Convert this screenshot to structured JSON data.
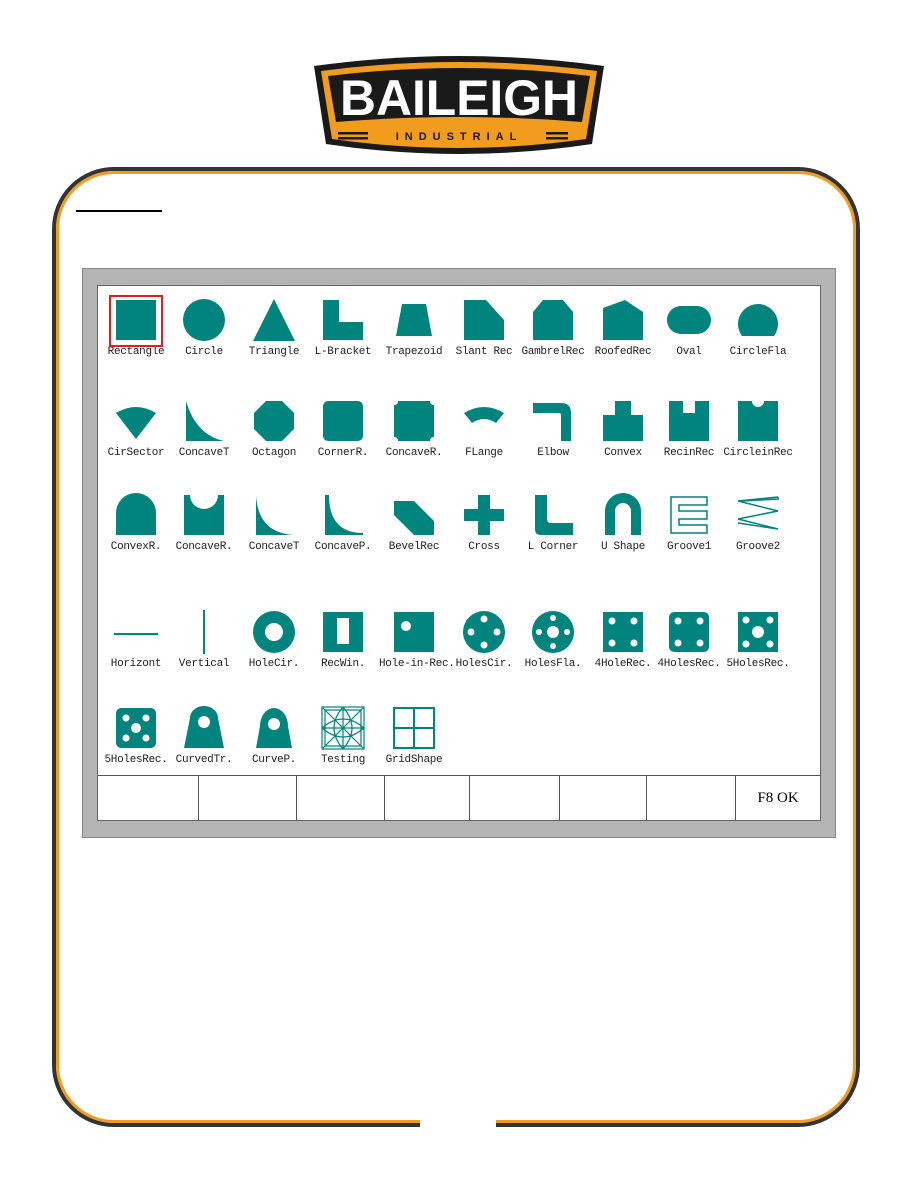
{
  "logo": {
    "brand": "BAILEIGH",
    "sub": "INDUSTRIAL",
    "colors": {
      "orange": "#f29c1f",
      "black": "#1a1a1a"
    }
  },
  "accent_color": "#00847d",
  "selection_color": "#e02020",
  "selected_index": 0,
  "shapes": [
    [
      {
        "label": "Rectangle",
        "icon": "rectangle"
      },
      {
        "label": "Circle",
        "icon": "circle"
      },
      {
        "label": "Triangle",
        "icon": "triangle"
      },
      {
        "label": "L-Bracket",
        "icon": "l-bracket"
      },
      {
        "label": "Trapezoid",
        "icon": "trapezoid"
      },
      {
        "label": "Slant Rec",
        "icon": "slant-rec"
      },
      {
        "label": "GambrelRec",
        "icon": "gambrel-rec"
      },
      {
        "label": "RoofedRec",
        "icon": "roofed-rec"
      },
      {
        "label": "Oval",
        "icon": "oval"
      },
      {
        "label": "CircleFla",
        "icon": "circle-flat"
      }
    ],
    [
      {
        "label": "CirSector",
        "icon": "cir-sector"
      },
      {
        "label": "ConcaveT",
        "icon": "concave-t"
      },
      {
        "label": "Octagon",
        "icon": "octagon"
      },
      {
        "label": "CornerR.",
        "icon": "corner-r"
      },
      {
        "label": "ConcaveR.",
        "icon": "concave-r"
      },
      {
        "label": "FLange",
        "icon": "flange"
      },
      {
        "label": "Elbow",
        "icon": "elbow"
      },
      {
        "label": "Convex",
        "icon": "convex"
      },
      {
        "label": "RecinRec",
        "icon": "rec-in-rec"
      },
      {
        "label": "CircleinRec",
        "icon": "circle-in-rec"
      }
    ],
    [
      {
        "label": "ConvexR.",
        "icon": "convex-r"
      },
      {
        "label": "ConcaveR.",
        "icon": "concave-r2"
      },
      {
        "label": "ConcaveT",
        "icon": "concave-t2"
      },
      {
        "label": "ConcaveP.",
        "icon": "concave-p"
      },
      {
        "label": "BevelRec",
        "icon": "bevel-rec"
      },
      {
        "label": "Cross",
        "icon": "cross"
      },
      {
        "label": "L Corner",
        "icon": "l-corner"
      },
      {
        "label": "U Shape",
        "icon": "u-shape"
      },
      {
        "label": "Groove1",
        "icon": "groove1"
      },
      {
        "label": "Groove2",
        "icon": "groove2"
      }
    ],
    [
      {
        "label": "Horizont",
        "icon": "horizontal-line"
      },
      {
        "label": "Vertical",
        "icon": "vertical-line"
      },
      {
        "label": "HoleCir.",
        "icon": "hole-circle"
      },
      {
        "label": "RecWin.",
        "icon": "rec-window"
      },
      {
        "label": "Hole-in-Rec.",
        "icon": "hole-in-rec"
      },
      {
        "label": "HolesCir.",
        "icon": "holes-circle"
      },
      {
        "label": "HolesFla.",
        "icon": "holes-flange"
      },
      {
        "label": "4HoleRec.",
        "icon": "4-hole-rec"
      },
      {
        "label": "4HolesRec.",
        "icon": "4-holes-rec"
      },
      {
        "label": "5HolesRec.",
        "icon": "5-holes-rec"
      }
    ],
    [
      {
        "label": "5HolesRec.",
        "icon": "5-holes-rec2"
      },
      {
        "label": "CurvedTr.",
        "icon": "curved-tr"
      },
      {
        "label": "CurveP.",
        "icon": "curve-p"
      },
      {
        "label": "Testing",
        "icon": "testing"
      },
      {
        "label": "GridShape",
        "icon": "grid-shape"
      }
    ]
  ],
  "function_keys": [
    "",
    "",
    "",
    "",
    "",
    "",
    "",
    "F8 OK"
  ]
}
